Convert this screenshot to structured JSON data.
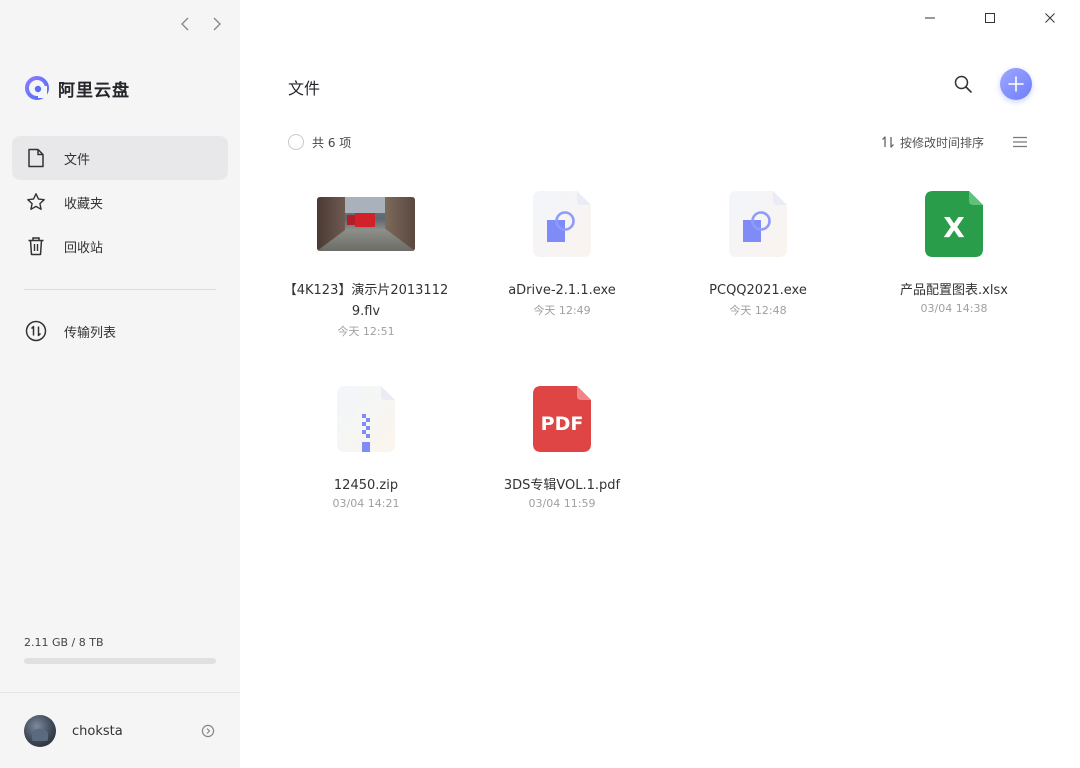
{
  "app": {
    "name": "阿里云盘",
    "brand_color": "#5b6cf6"
  },
  "sidebar": {
    "items": [
      {
        "label": "文件",
        "icon": "file-icon",
        "active": true
      },
      {
        "label": "收藏夹",
        "icon": "star-icon",
        "active": false
      },
      {
        "label": "回收站",
        "icon": "trash-icon",
        "active": false
      }
    ],
    "transfer": {
      "label": "传输列表",
      "icon": "transfer-icon"
    },
    "storage": {
      "text": "2.11 GB / 8 TB",
      "used_fraction": 0.0003
    },
    "user": {
      "name": "choksta"
    }
  },
  "main": {
    "title": "文件",
    "count_text": "共 6 项",
    "sort_label": "按修改时间排序",
    "files": [
      {
        "name": "【4K123】演示片20131129.flv",
        "date": "今天 12:51",
        "type": "video"
      },
      {
        "name": "aDrive-2.1.1.exe",
        "date": "今天 12:49",
        "type": "exe"
      },
      {
        "name": "PCQQ2021.exe",
        "date": "今天 12:48",
        "type": "exe"
      },
      {
        "name": "产品配置图表.xlsx",
        "date": "03/04 14:38",
        "type": "xlsx"
      },
      {
        "name": "12450.zip",
        "date": "03/04 14:21",
        "type": "zip"
      },
      {
        "name": "3DS专辑VOL.1.pdf",
        "date": "03/04 11:59",
        "type": "pdf"
      }
    ],
    "icon_labels": {
      "xlsx": "X",
      "pdf": "PDF"
    }
  },
  "colors": {
    "accent": "#7a87fb",
    "excel": "#2a9d4a",
    "pdf": "#e04545",
    "sidebar_bg": "#f5f5f6"
  }
}
